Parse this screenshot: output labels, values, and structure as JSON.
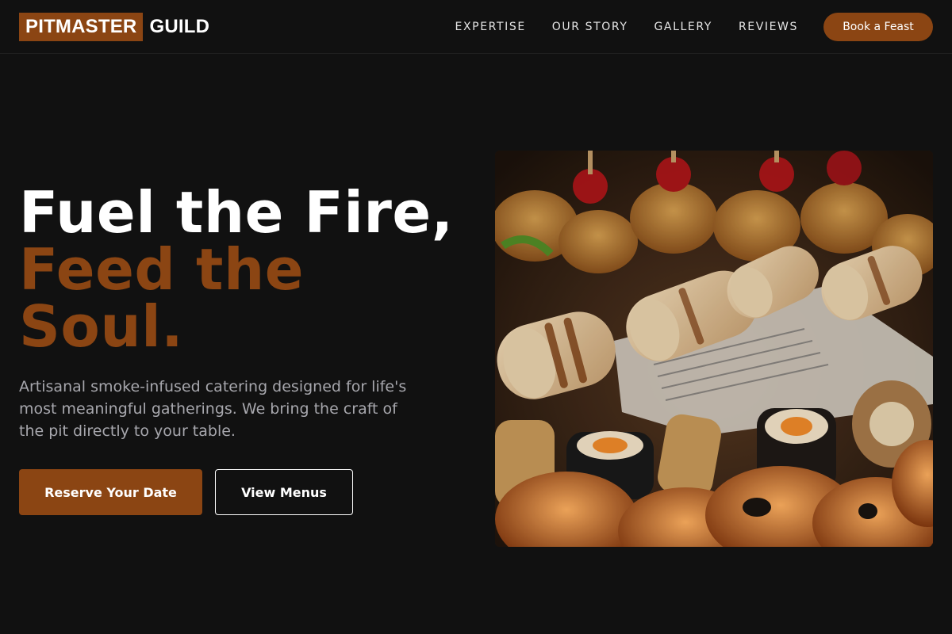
{
  "brand": {
    "highlight": "PITMASTER",
    "rest": "GUILD"
  },
  "nav": {
    "links": [
      "EXPERTISE",
      "OUR STORY",
      "GALLERY",
      "REVIEWS"
    ],
    "cta": "Book a Feast"
  },
  "hero": {
    "line1": "Fuel the Fire,",
    "line2": "Feed the Soul.",
    "subtitle": "Artisanal smoke-infused catering designed for life's most meaningful gatherings. We bring the craft of the pit directly to your table.",
    "primary_button": "Reserve Your Date",
    "secondary_button": "View Menus",
    "image_alt": "catering-food-platter"
  },
  "colors": {
    "accent": "#8b4513",
    "background": "#111111",
    "text_muted": "#a7a7ad"
  }
}
